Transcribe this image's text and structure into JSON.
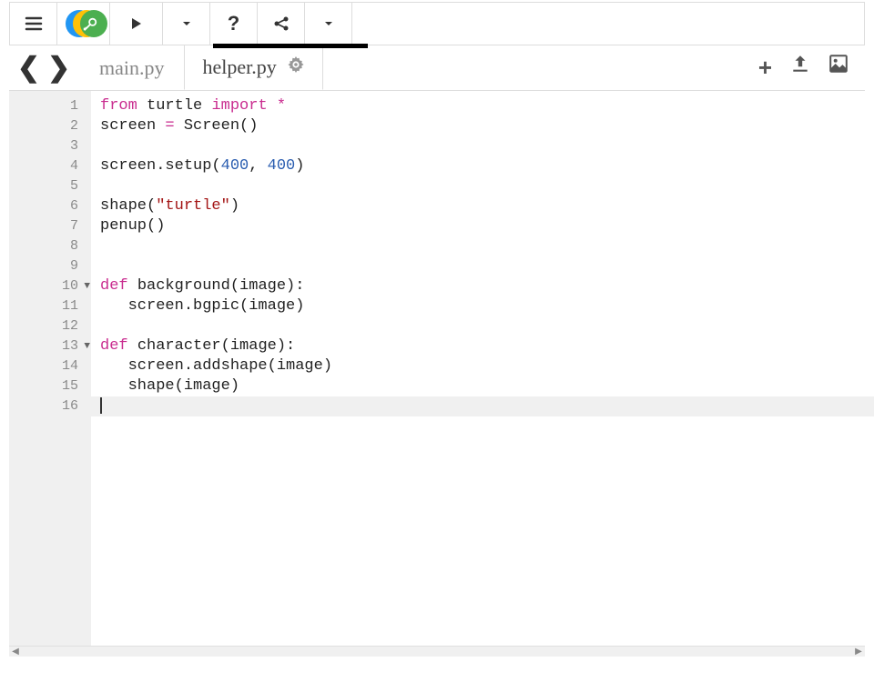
{
  "toolbar": {
    "menu_icon": "≡",
    "play_icon": "▶",
    "dropdown1_icon": "▼",
    "help_icon": "?",
    "share_icon": "share",
    "dropdown2_icon": "▼"
  },
  "nav": {
    "back": "❮",
    "forward": "❯"
  },
  "tabs": [
    {
      "label": "main.py",
      "active": false
    },
    {
      "label": "helper.py",
      "active": true,
      "gear": "⚙"
    }
  ],
  "right_icons": {
    "add": "+",
    "upload": "upload",
    "image": "image"
  },
  "code": {
    "lines": [
      {
        "n": 1,
        "fold": "",
        "tokens": [
          {
            "t": "from",
            "c": "kw"
          },
          {
            "t": " ",
            "c": "plain"
          },
          {
            "t": "turtle",
            "c": "plain"
          },
          {
            "t": " ",
            "c": "plain"
          },
          {
            "t": "import",
            "c": "kw"
          },
          {
            "t": " ",
            "c": "plain"
          },
          {
            "t": "*",
            "c": "op"
          }
        ]
      },
      {
        "n": 2,
        "fold": "",
        "tokens": [
          {
            "t": "screen ",
            "c": "plain"
          },
          {
            "t": "=",
            "c": "op"
          },
          {
            "t": " Screen()",
            "c": "plain"
          }
        ]
      },
      {
        "n": 3,
        "fold": "",
        "tokens": []
      },
      {
        "n": 4,
        "fold": "",
        "tokens": [
          {
            "t": "screen.setup(",
            "c": "plain"
          },
          {
            "t": "400",
            "c": "num"
          },
          {
            "t": ", ",
            "c": "plain"
          },
          {
            "t": "400",
            "c": "num"
          },
          {
            "t": ")",
            "c": "plain"
          }
        ]
      },
      {
        "n": 5,
        "fold": "",
        "tokens": []
      },
      {
        "n": 6,
        "fold": "",
        "tokens": [
          {
            "t": "shape(",
            "c": "plain"
          },
          {
            "t": "\"turtle\"",
            "c": "str"
          },
          {
            "t": ")",
            "c": "plain"
          }
        ]
      },
      {
        "n": 7,
        "fold": "",
        "tokens": [
          {
            "t": "penup()",
            "c": "plain"
          }
        ]
      },
      {
        "n": 8,
        "fold": "",
        "tokens": []
      },
      {
        "n": 9,
        "fold": "",
        "tokens": []
      },
      {
        "n": 10,
        "fold": "▼",
        "tokens": [
          {
            "t": "def",
            "c": "def"
          },
          {
            "t": " ",
            "c": "plain"
          },
          {
            "t": "background",
            "c": "name"
          },
          {
            "t": "(image):",
            "c": "plain"
          }
        ]
      },
      {
        "n": 11,
        "fold": "",
        "tokens": [
          {
            "t": "   screen.bgpic(image)",
            "c": "plain"
          }
        ]
      },
      {
        "n": 12,
        "fold": "",
        "tokens": []
      },
      {
        "n": 13,
        "fold": "▼",
        "tokens": [
          {
            "t": "def",
            "c": "def"
          },
          {
            "t": " ",
            "c": "plain"
          },
          {
            "t": "character",
            "c": "name"
          },
          {
            "t": "(image):",
            "c": "plain"
          }
        ]
      },
      {
        "n": 14,
        "fold": "",
        "tokens": [
          {
            "t": "   screen.addshape(image)",
            "c": "plain"
          }
        ]
      },
      {
        "n": 15,
        "fold": "",
        "tokens": [
          {
            "t": "   shape(image)",
            "c": "plain"
          }
        ]
      },
      {
        "n": 16,
        "fold": "",
        "tokens": [],
        "current": true
      }
    ]
  },
  "scrollbar": {
    "left": "◀",
    "right": "▶"
  }
}
